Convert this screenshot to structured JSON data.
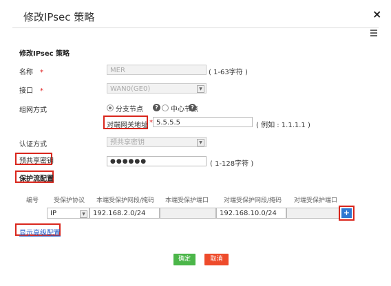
{
  "dialog": {
    "title": "修改IPsec 策略",
    "close_label": "×"
  },
  "section_title": "修改IPsec 策略",
  "fields": {
    "name": {
      "label": "名称",
      "required_mark": "*",
      "value": "MER",
      "hint": "( 1-63字符 )"
    },
    "interface": {
      "label": "接口",
      "required_mark": "*",
      "value": "WAN0(GE0)"
    },
    "networking": {
      "label": "组网方式",
      "options": [
        "分支节点",
        "中心节点"
      ],
      "selected": "分支节点"
    },
    "peer_gateway": {
      "label": "对端网关地址",
      "required_mark": "*",
      "value": "5.5.5.5",
      "hint": "( 例如 : 1.1.1.1 )"
    },
    "auth_method": {
      "label": "认证方式",
      "value": "预共享密钥"
    },
    "psk": {
      "label": "预共享密钥",
      "value": "●●●●●●",
      "hint": "( 1-128字符 )"
    }
  },
  "protect_flow": {
    "title": "保护流配置",
    "columns": [
      "编号",
      "受保护协议",
      "本端受保护网段/掩码",
      "本端受保护端口",
      "对端受保护网段/掩码",
      "对端受保护端口"
    ],
    "row": {
      "protocol": "IP",
      "local_net": "192.168.2.0/24",
      "local_port": "",
      "remote_net": "192.168.10.0/24",
      "remote_port": ""
    },
    "add_label": "+"
  },
  "advanced_link": "显示高级配置",
  "buttons": {
    "ok": "确定",
    "cancel": "取消"
  },
  "colors": {
    "highlight": "#d9261c",
    "ok": "#4bb649",
    "cancel": "#ee4b2b",
    "link": "#1a54c4",
    "add": "#2e78d2"
  }
}
